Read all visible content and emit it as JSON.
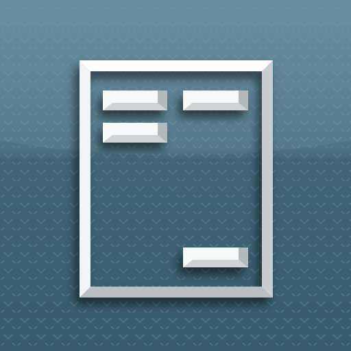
{
  "app": {
    "icon": "document-layout-icon",
    "accessible_label": ""
  },
  "colors": {
    "background_top": "#6a8fa0",
    "background_mid": "#4d7283",
    "background_bottom": "#34596a",
    "pattern_dot": "#5f8a9c",
    "frame_face": "#ffffff",
    "frame_shade": "#cfd3d6",
    "frame_dark": "#9aa3a8",
    "shadow": "#1f3b48"
  },
  "layout_blocks": [
    {
      "name": "block-top-left"
    },
    {
      "name": "block-top-right"
    },
    {
      "name": "block-mid-left"
    },
    {
      "name": "block-bottom-right"
    }
  ]
}
